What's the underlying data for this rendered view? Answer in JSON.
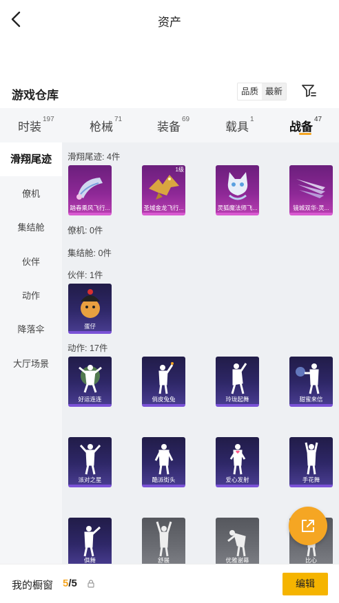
{
  "header": {
    "title": "资产"
  },
  "warehouse": {
    "title": "游戏仓库",
    "sort_options": [
      "品质",
      "最新"
    ]
  },
  "tabs": [
    {
      "label": "时装",
      "count": "197"
    },
    {
      "label": "枪械",
      "count": "71"
    },
    {
      "label": "装备",
      "count": "69"
    },
    {
      "label": "载具",
      "count": "1"
    },
    {
      "label": "战备",
      "count": "47",
      "active": true
    }
  ],
  "sidebar": {
    "items": [
      "滑翔尾迹",
      "僚机",
      "集结舱",
      "伙伴",
      "动作",
      "降落伞",
      "大厅场景"
    ]
  },
  "sections": {
    "glide": {
      "label": "滑翔尾迹: 4件",
      "items": [
        {
          "name": "踏春乘风飞行...",
          "rarity": "pink",
          "icon": "scroll-trail-icon"
        },
        {
          "name": "圣域金龙飞行...",
          "rarity": "pink",
          "icon": "golden-dragon-icon",
          "badge": "1级"
        },
        {
          "name": "灵狐魔法师飞...",
          "rarity": "pink",
          "icon": "fox-mage-icon"
        },
        {
          "name": "镜城双华·灵...",
          "rarity": "pink",
          "icon": "crystal-blades-icon"
        }
      ]
    },
    "wingman": {
      "label": "僚机: 0件"
    },
    "pod": {
      "label": "集结舱: 0件"
    },
    "partner": {
      "label": "伙伴: 1件",
      "items": [
        {
          "name": "蛋仔",
          "rarity": "purple",
          "icon": "eggy-partner-icon"
        }
      ]
    },
    "emote": {
      "label": "动作: 17件",
      "items": [
        {
          "name": "好运连连",
          "rarity": "purple",
          "icon": "lucky-dance-icon"
        },
        {
          "name": "俏皮兔兔",
          "rarity": "purple",
          "icon": "bunny-dance-icon"
        },
        {
          "name": "玲珑起舞",
          "rarity": "purple",
          "icon": "graceful-dance-icon"
        },
        {
          "name": "甜蜜来信",
          "rarity": "purple",
          "icon": "sweet-letter-icon"
        },
        {
          "name": "派对之星",
          "rarity": "purple",
          "icon": "party-star-icon"
        },
        {
          "name": "酷派街头",
          "rarity": "purple",
          "icon": "street-cool-icon"
        },
        {
          "name": "爱心发射",
          "rarity": "purple",
          "icon": "heart-shot-icon"
        },
        {
          "name": "手花舞",
          "rarity": "purple",
          "icon": "hand-flower-icon"
        },
        {
          "name": "俱舞",
          "rarity": "purple",
          "icon": "group-dance-icon"
        },
        {
          "name": "舒展",
          "rarity": "gray",
          "icon": "stretch-icon"
        },
        {
          "name": "优雅谢幕",
          "rarity": "gray",
          "icon": "elegant-bow-icon"
        },
        {
          "name": "比心",
          "rarity": "gray",
          "icon": "finger-heart-icon"
        }
      ]
    }
  },
  "bottom": {
    "wardrobe_label": "我的橱窗",
    "current": "5",
    "separator": "/",
    "total": "5",
    "edit_label": "编辑"
  },
  "colors": {
    "accent": "#f5a623",
    "edit_button": "#f5b400",
    "rarity_purple": "#7a52d6",
    "rarity_pink": "#d85ad0",
    "rarity_gray": "#8c8e94"
  }
}
